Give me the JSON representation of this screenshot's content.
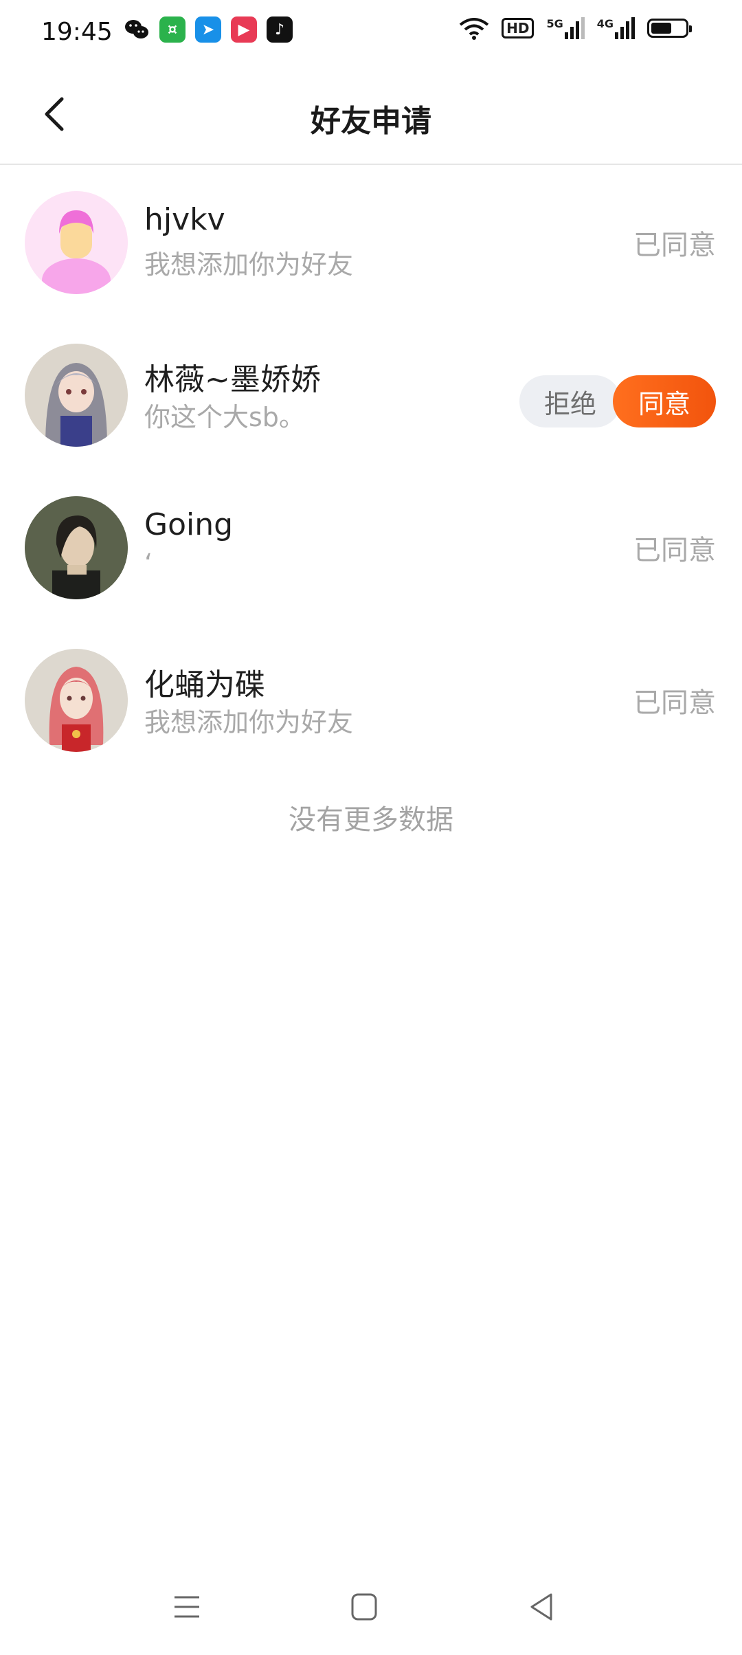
{
  "status_bar": {
    "time": "19:45",
    "apps": [
      "wechat-icon",
      "shop-icon",
      "bilibili-icon",
      "video-play-icon",
      "douyin-icon"
    ],
    "hd_label": "HD",
    "signal_5g": "5G",
    "signal_4g": "4G",
    "battery_level": 0.6
  },
  "header": {
    "title": "好友申请",
    "back_icon": "chevron-left-icon"
  },
  "requests": [
    {
      "name": "hjvkv",
      "message": "我想添加你为好友",
      "status": "已同意",
      "avatar": "default-pink-avatar"
    },
    {
      "name": "林薇~墨娇娇",
      "message": "你这个大sb。",
      "status": "",
      "reject_label": "拒绝",
      "accept_label": "同意",
      "avatar": "anime-girl-avatar"
    },
    {
      "name": "Going",
      "message": "‘",
      "status": "已同意",
      "avatar": "dark-hair-man-avatar"
    },
    {
      "name": "化蛹为碟",
      "message": "我想添加你为好友",
      "status": "已同意",
      "avatar": "pink-hair-girl-avatar"
    }
  ],
  "footer_text": "没有更多数据",
  "colors": {
    "accent": "#f75c12",
    "muted_text": "#a9a9a9",
    "reject_bg": "#edeff3"
  },
  "nav_bar": {
    "menu_icon": "menu-icon",
    "home_icon": "square-home-icon",
    "back_icon": "triangle-back-icon"
  }
}
